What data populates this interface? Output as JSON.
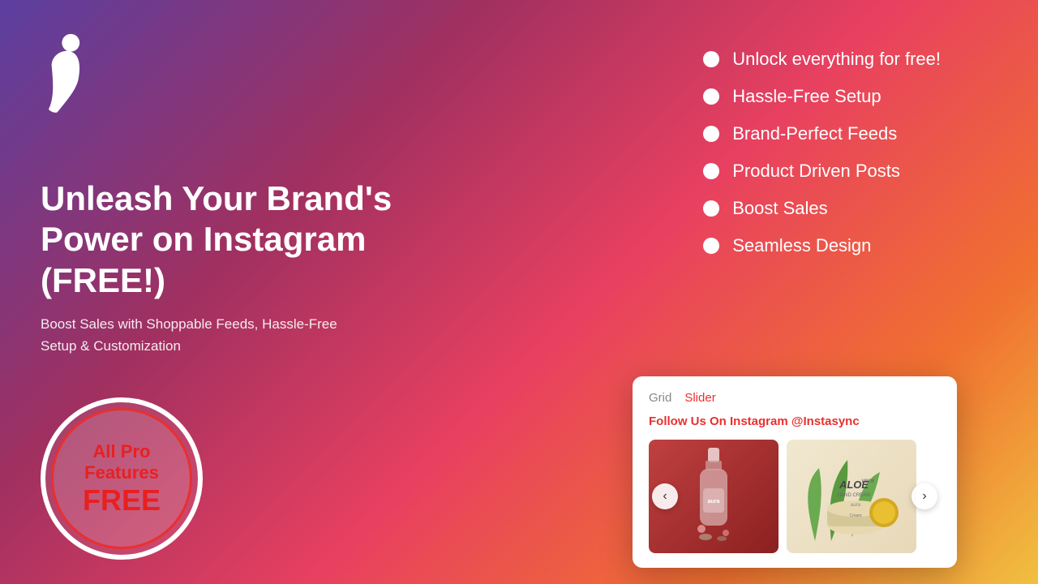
{
  "background": {
    "gradient": "purple to orange-yellow"
  },
  "logo": {
    "alt": "Instasync logo icon"
  },
  "left_panel": {
    "headline": "Unleash Your Brand's Power on Instagram (FREE!)",
    "subheadline": "Boost Sales with Shoppable Feeds, Hassle-Free Setup & Customization"
  },
  "badge": {
    "line1": "All Pro",
    "line2": "Features",
    "line3": "FREE"
  },
  "features": [
    {
      "label": "Unlock everything for free!"
    },
    {
      "label": "Hassle-Free Setup"
    },
    {
      "label": "Brand-Perfect Feeds"
    },
    {
      "label": "Product Driven Posts"
    },
    {
      "label": "Boost Sales"
    },
    {
      "label": "Seamless Design"
    }
  ],
  "widget": {
    "tabs": [
      {
        "label": "Grid",
        "active": false
      },
      {
        "label": "Slider",
        "active": true
      }
    ],
    "title": "Follow Us On Instagram",
    "handle": "@Instasync",
    "nav_prev": "‹",
    "nav_next": "›",
    "images": [
      {
        "type": "cosmetic-bottle-red",
        "alt": "Aura cosmetic bottle on red background"
      },
      {
        "type": "aloe-cream-green",
        "alt": "Aloe Vera hand cream with green plant"
      }
    ]
  }
}
